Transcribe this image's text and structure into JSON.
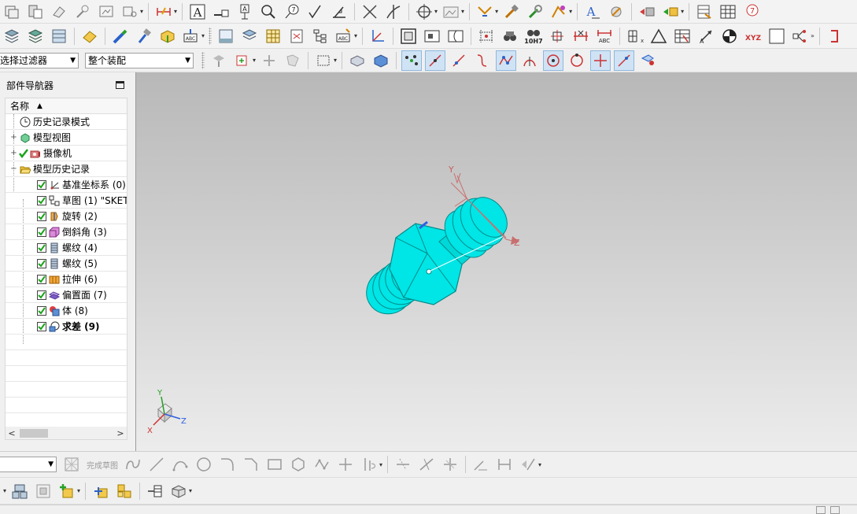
{
  "selection_bar": {
    "filter_value": "选择过滤器",
    "scope_value": "整个装配"
  },
  "sketch_bar": {
    "finish_label": "完成草图"
  },
  "navigator": {
    "title": "部件导航器",
    "column_name": "名称",
    "nodes": [
      {
        "label": "历史记录模式",
        "icon": "clock-icon"
      },
      {
        "label": "模型视图",
        "icon": "model-views-icon"
      },
      {
        "label": "摄像机",
        "icon": "camera-icon"
      },
      {
        "label": "模型历史记录",
        "icon": "folder-open-icon"
      }
    ],
    "features": [
      {
        "label": "基准坐标系 (0)",
        "icon": "datum-csys-icon"
      },
      {
        "label": "草图 (1) \"SKET",
        "icon": "sketch-icon"
      },
      {
        "label": "旋转 (2)",
        "icon": "revolve-icon"
      },
      {
        "label": "倒斜角 (3)",
        "icon": "chamfer-icon"
      },
      {
        "label": "螺纹 (4)",
        "icon": "thread-icon"
      },
      {
        "label": "螺纹 (5)",
        "icon": "thread-icon"
      },
      {
        "label": "拉伸 (6)",
        "icon": "extrude-icon"
      },
      {
        "label": "偏置面 (7)",
        "icon": "offset-face-icon"
      },
      {
        "label": "体 (8)",
        "icon": "body-icon"
      },
      {
        "label": "求差 (9)",
        "icon": "subtract-icon"
      }
    ]
  },
  "viewport": {
    "part_axes": {
      "x": "",
      "y": "Y",
      "z": "Z"
    },
    "triad": {
      "x": "X",
      "y": "Y",
      "z": "Z"
    }
  },
  "toolbar_text": {
    "fit_tolerance": "10H7",
    "abc": "ABC",
    "xyz": "XYZ",
    "tb1_abc": "A"
  },
  "colors": {
    "part_cyan": "#00e5e5",
    "axis_red": "#d03030",
    "axis_green": "#22a022",
    "axis_blue": "#2f5fe0",
    "checkmark": "#1aa31a"
  }
}
